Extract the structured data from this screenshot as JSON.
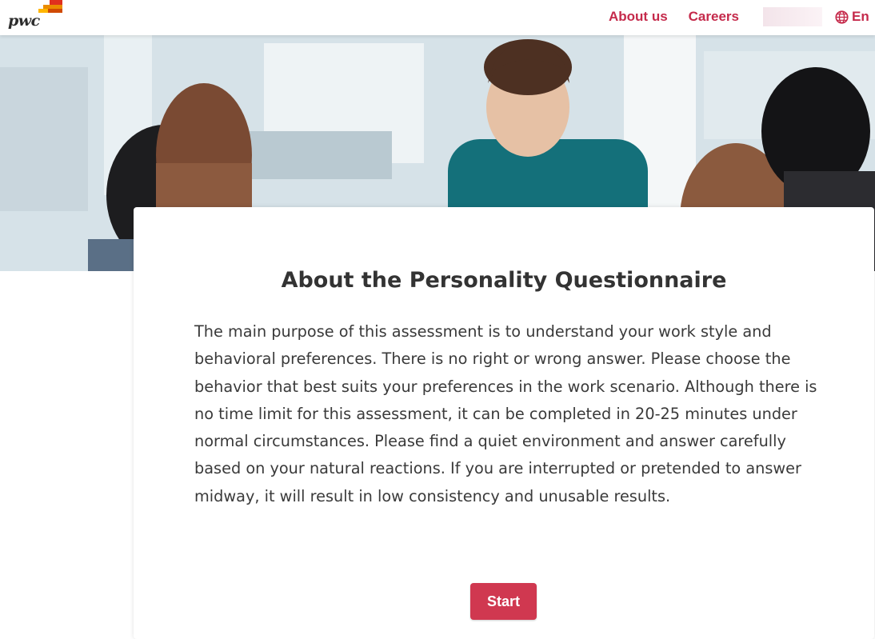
{
  "brand": {
    "logo_text": "pwc"
  },
  "nav": {
    "about_label": "About us",
    "careers_label": "Careers",
    "language_label": "En",
    "accent_color": "#c52a4b"
  },
  "hero": {
    "image": "office-meeting-photo"
  },
  "card": {
    "title": "About the Personality Questionnaire",
    "body": "The main purpose of this assessment is to understand your work style and behavioral preferences. There is no right or wrong answer. Please choose the behavior that best suits your preferences in the work scenario. Although there is no time limit for this assessment, it can be completed in 20-25 minutes under normal circumstances. Please find a quiet environment and answer carefully based on your natural reactions. If you are interrupted or pretended to answer midway, it will result in low consistency and unusable results.",
    "start_label": "Start",
    "button_color": "#d03850"
  }
}
